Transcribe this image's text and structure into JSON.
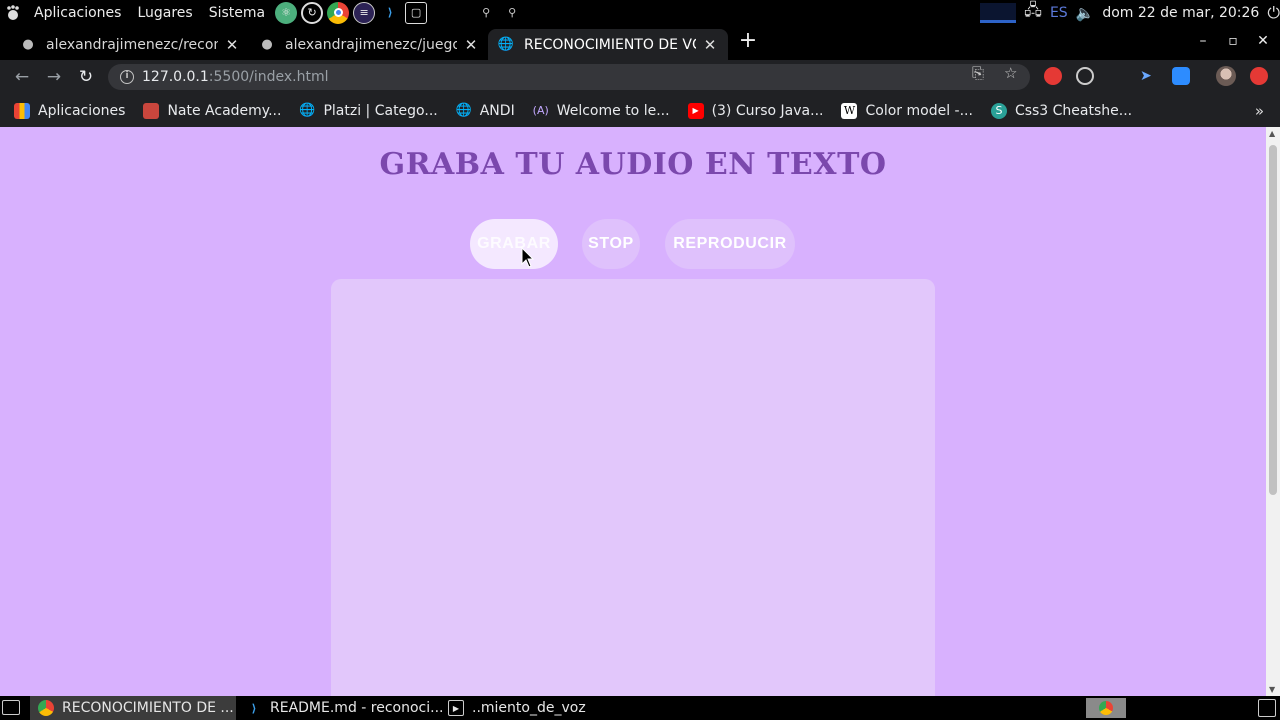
{
  "top_panel": {
    "menu": [
      "Aplicaciones",
      "Lugares",
      "Sistema"
    ],
    "language": "ES",
    "clock": "dom 22 de mar, 20:26"
  },
  "tabs": [
    {
      "title": "alexandrajimenezc/recon",
      "icon": "github-icon",
      "active": false
    },
    {
      "title": "alexandrajimenezc/juego",
      "icon": "github-icon",
      "active": false
    },
    {
      "title": "RECONOCIMIENTO DE VC",
      "icon": "globe-icon",
      "active": true
    }
  ],
  "address_bar": {
    "host": "127.0.0.1",
    "path": ":5500/index.html"
  },
  "bookmarks": [
    {
      "label": "Aplicaciones",
      "icon": "apps-grid-icon"
    },
    {
      "label": "Nate Academy...",
      "icon": "nate-academy-icon"
    },
    {
      "label": "Platzi | Catego...",
      "icon": "globe-icon"
    },
    {
      "label": "ANDI",
      "icon": "globe-icon"
    },
    {
      "label": "Welcome to le...",
      "icon": "angular-icon"
    },
    {
      "label": "(3) Curso Java...",
      "icon": "youtube-icon"
    },
    {
      "label": "Color model -...",
      "icon": "wikipedia-icon"
    },
    {
      "label": "Css3 Cheatshe...",
      "icon": "css-icon"
    }
  ],
  "page": {
    "title": "GRABA TU AUDIO EN TEXTO",
    "buttons": {
      "record": "GRABAR",
      "stop": "STOP",
      "play": "REPRODUCIR"
    },
    "transcript": ""
  },
  "taskbar": [
    {
      "label": "RECONOCIMIENTO DE ...",
      "icon": "chrome-icon",
      "active": true
    },
    {
      "label": "README.md - reconoci...",
      "icon": "vscode-icon",
      "active": false
    },
    {
      "label": "..miento_de_voz",
      "icon": "terminal-icon",
      "active": false
    }
  ],
  "colors": {
    "page_background": "#d8b1fe",
    "title": "#7b48ad",
    "button": "#dfc1fc",
    "button_hover": "#f4e8ff",
    "text_area": "#e2c7fb"
  }
}
